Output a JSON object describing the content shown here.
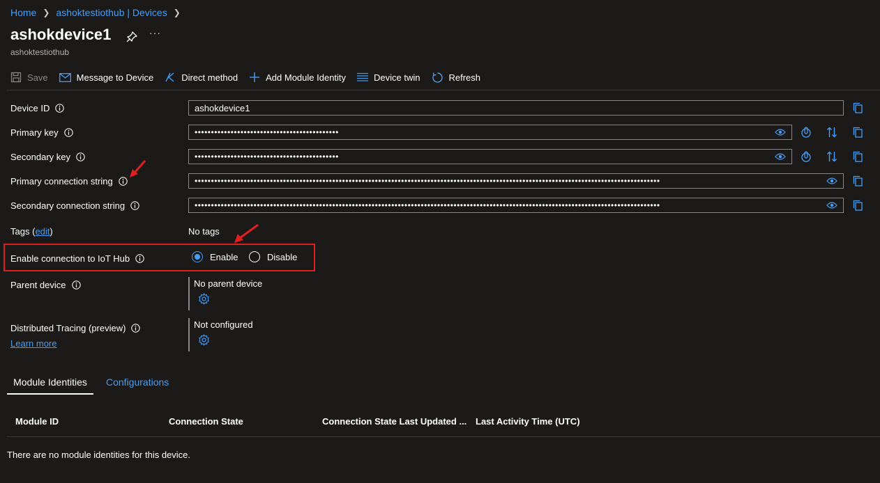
{
  "breadcrumb": {
    "items": [
      "Home",
      "ashoktestiothub | Devices"
    ]
  },
  "header": {
    "title": "ashokdevice1",
    "subtitle": "ashoktestiothub",
    "more": "···"
  },
  "toolbar": {
    "save": "Save",
    "message": "Message to Device",
    "direct_method": "Direct method",
    "add_module": "Add Module Identity",
    "device_twin": "Device twin",
    "refresh": "Refresh"
  },
  "form": {
    "device_id_label": "Device ID",
    "device_id_value": "ashokdevice1",
    "primary_key_label": "Primary key",
    "primary_key_value": "••••••••••••••••••••••••••••••••••••••••••••",
    "secondary_key_label": "Secondary key",
    "secondary_key_value": "••••••••••••••••••••••••••••••••••••••••••••",
    "primary_conn_label": "Primary connection string",
    "primary_conn_value": "••••••••••••••••••••••••••••••••••••••••••••••••••••••••••••••••••••••••••••••••••••••••••••••••••••••••••••••••••••••••••••••••••••••••••••••",
    "secondary_conn_label": "Secondary connection string",
    "secondary_conn_value": "••••••••••••••••••••••••••••••••••••••••••••••••••••••••••••••••••••••••••••••••••••••••••••••••••••••••••••••••••••••••••••••••••••••••••••••",
    "tags_label": "Tags",
    "tags_open": "(",
    "tags_edit": "edit",
    "tags_close": ")",
    "tags_value": "No tags",
    "enable_conn_label": "Enable connection to IoT Hub",
    "enable_option": "Enable",
    "disable_option": "Disable",
    "enable_selected": "Enable",
    "parent_label": "Parent device",
    "parent_value": "No parent device",
    "tracing_label": "Distributed Tracing (preview)",
    "tracing_value": "Not configured",
    "learn_more": "Learn more"
  },
  "tabs": {
    "module_identities": "Module Identities",
    "configurations": "Configurations",
    "active": "Module Identities"
  },
  "table": {
    "columns": [
      "Module ID",
      "Connection State",
      "Connection State Last Updated ...",
      "Last Activity Time (UTC)"
    ],
    "empty_message": "There are no module identities for this device."
  },
  "colors": {
    "background": "#1b1a19",
    "accent": "#479ef5",
    "highlight": "#e02020",
    "border": "#8a8886"
  },
  "icons": [
    "pin-icon",
    "save-icon",
    "mail-icon",
    "direct-method-icon",
    "plus-icon",
    "list-icon",
    "refresh-icon",
    "info-icon",
    "eye-icon",
    "copy-icon",
    "regenerate-key-icon",
    "swap-icon",
    "gear-icon"
  ]
}
